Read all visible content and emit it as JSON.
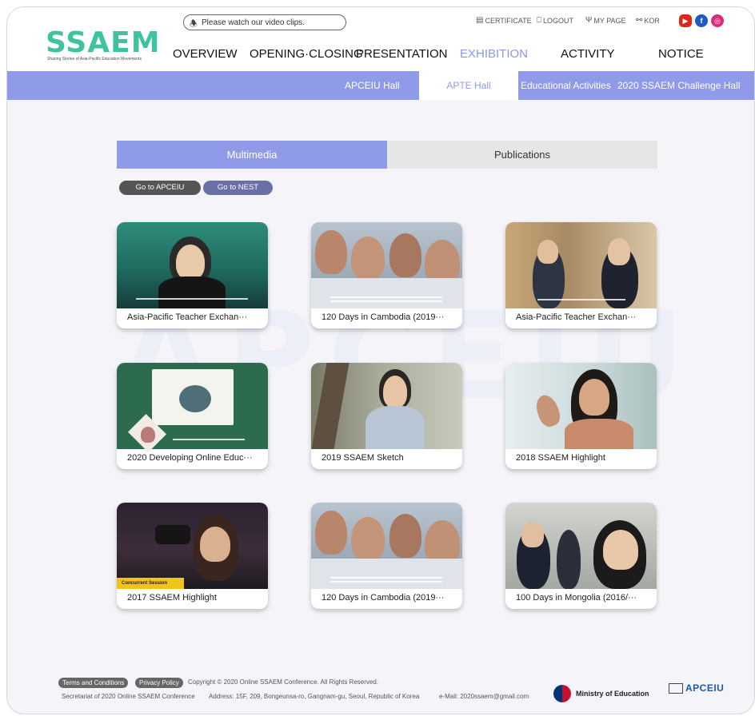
{
  "logo": {
    "text": "SSAEM",
    "subtitle": "Sharing Stories of Asia-Pacific Education Movements"
  },
  "topbar": {
    "notice": "Please watch our video clips.",
    "certificate": "CERTIFICATE",
    "logout": "LOGOUT",
    "mypage": "MY PAGE",
    "language": "KOR",
    "youtube": "▶",
    "facebook": "f",
    "instagram": "◎"
  },
  "nav": [
    "OVERVIEW",
    "OPENING·CLOSING",
    "PRESENTATION",
    "EXHIBITION",
    "ACTIVITY",
    "NOTICE"
  ],
  "subnav": [
    "APCEIU Hall",
    "APTE Hall",
    "Educational Activities",
    "2020 SSAEM Challenge Hall"
  ],
  "watermark": "APCEIU",
  "tabs": [
    "Multimedia",
    "Publications"
  ],
  "buttons": {
    "go_apceiu": "Go to APCEIU",
    "go_nest": "Go to NEST"
  },
  "videos": [
    "Asia-Pacific Teacher Exchan···",
    "120 Days in Cambodia (2019···",
    "Asia-Pacific Teacher Exchan···",
    "2020 Developing Online Educ···",
    "2019 SSAEM Sketch",
    "2018 SSAEM Highlight",
    "2017 SSAEM Highlight",
    "120 Days in Cambodia (2019···",
    "100 Days in Mongolia (2016/···"
  ],
  "thumb_badge": "Concurrent Session",
  "footer": {
    "terms": "Terms and Conditions",
    "privacy": "Privacy Policy",
    "copyright": "Copyright © 2020 Online SSAEM Conference. All Rights Reserved.",
    "secretariat": "Secretariat of 2020 Online SSAEM Conference",
    "address": "Address: 15F, 209, Bongeunsa-ro, Gangnam-gu, Seoul, Republic of Korea",
    "email": "e-Mail: 2020ssaem@gmail.com",
    "ministry": "Ministry of Education",
    "apceiu": "APCEIU"
  },
  "colors": {
    "accent": "#8f9be8",
    "logo": "#3ec2a0",
    "youtube": "#e0261b",
    "facebook": "#1e5bc6",
    "instagram": "#d92c7d"
  }
}
